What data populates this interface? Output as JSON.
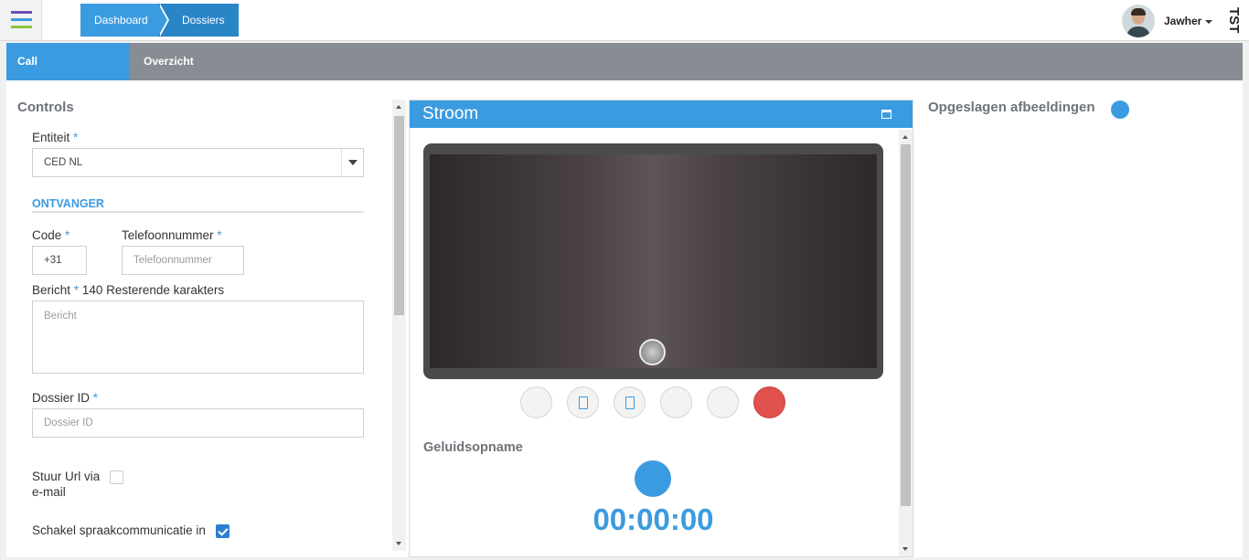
{
  "header": {
    "breadcrumbs": [
      "Dashboard",
      "Dossiers"
    ],
    "user": {
      "name": "Jawher"
    },
    "env_label": "TST",
    "menu_colors": [
      "#6b4fb3",
      "#3b9be0",
      "#8cc63f"
    ]
  },
  "tabs": [
    "Call",
    "Overzicht"
  ],
  "controls": {
    "title": "Controls",
    "entiteit": {
      "label": "Entiteit",
      "required": "*",
      "value": "CED NL"
    },
    "ontvanger_title": "ONTVANGER",
    "code": {
      "label": "Code",
      "required": "*",
      "value": "+31"
    },
    "telefoon": {
      "label": "Telefoonnummer",
      "required": "*",
      "placeholder": "Telefoonnummer"
    },
    "bericht": {
      "label": "Bericht",
      "required": "*",
      "remaining": "140 Resterende karakters",
      "placeholder": "Bericht"
    },
    "dossier": {
      "label": "Dossier ID",
      "required": "*",
      "placeholder": "Dossier ID"
    },
    "stuur_url": {
      "label_line1": "Stuur Url via",
      "label_line2": "e-mail",
      "checked": false
    },
    "spraak": {
      "label": "Schakel spraakcommunicatie in",
      "checked": true
    }
  },
  "stream": {
    "title": "Stroom",
    "geluidsopname": "Geluidsopname",
    "timer": "00:00:00"
  },
  "saved_images": {
    "title": "Opgeslagen afbeeldingen"
  }
}
